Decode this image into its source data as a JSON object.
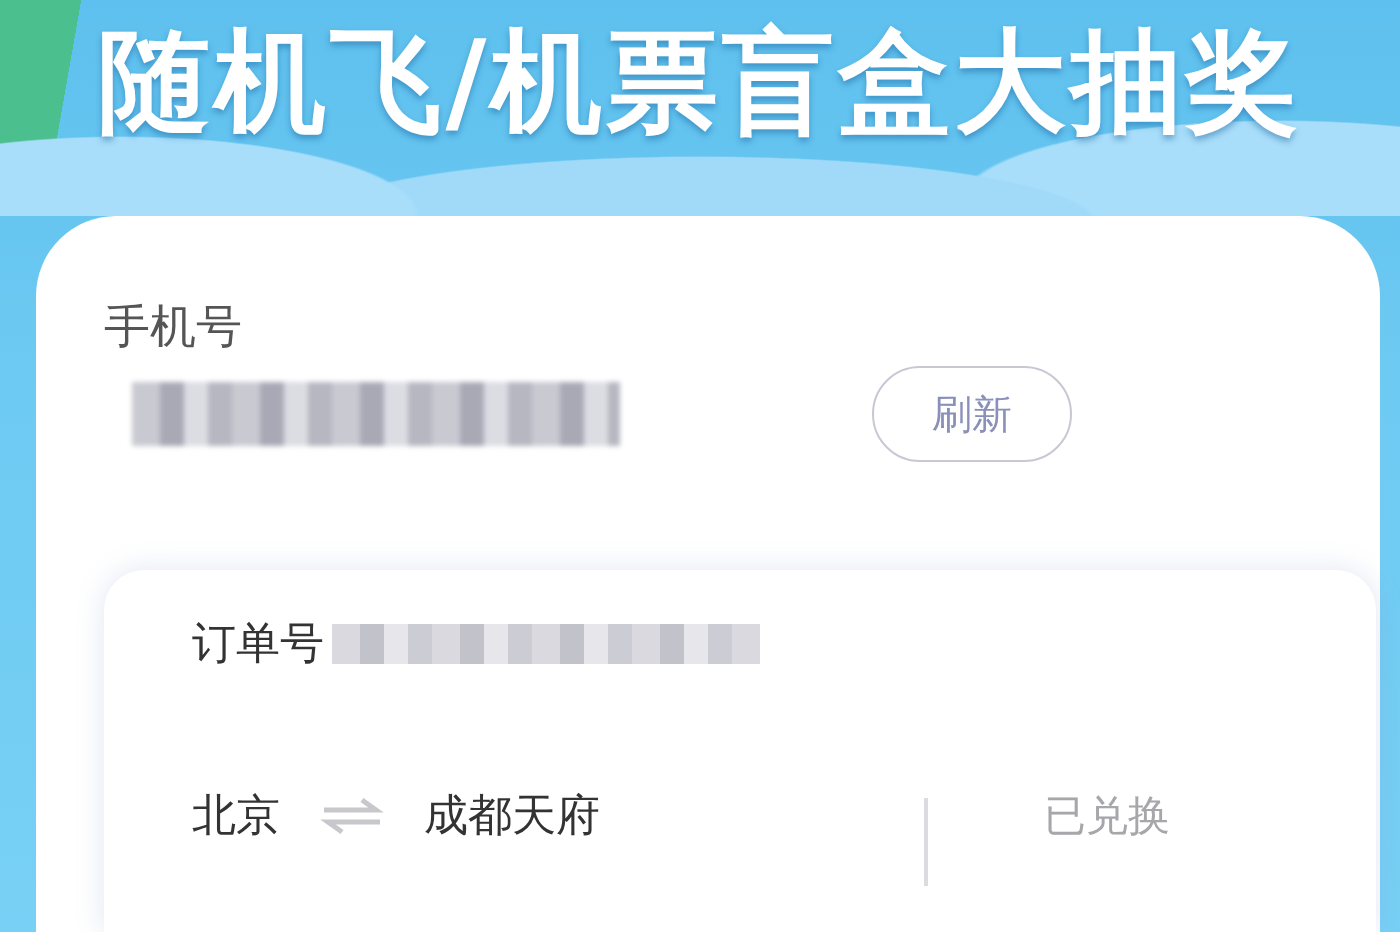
{
  "banner": {
    "title": "随机飞/机票盲盒大抽奖"
  },
  "account": {
    "phone_label": "手机号",
    "refresh_button": "刷新"
  },
  "order": {
    "order_label": "订单号",
    "route": {
      "from": "北京",
      "to": "成都天府"
    },
    "status": "已兑换"
  }
}
